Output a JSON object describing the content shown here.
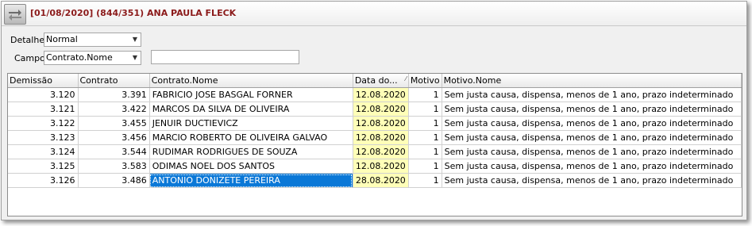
{
  "window": {
    "title": "[01/08/2020] (844/351) ANA PAULA FLECK",
    "nav_icon": "swap-arrows-icon"
  },
  "filters": {
    "detalhe_label": "Detalhe",
    "detalhe_value": "Normal",
    "campo_label": "Campo",
    "campo_value": "Contrato.Nome",
    "search_value": ""
  },
  "colors": {
    "title": "#8b1a1a",
    "date_highlight": "#ffffb8",
    "selection": "#0a78d7"
  },
  "table": {
    "columns": [
      "Demissão",
      "Contrato",
      "Contrato.Nome",
      "Data do...",
      "Motivo",
      "Motivo.Nome"
    ],
    "sorted_column": "Data do...",
    "rows": [
      [
        "3.120",
        "3.391",
        "FABRICIO JOSE BASGAL FORNER",
        "12.08.2020",
        "1",
        "Sem justa causa, dispensa, menos de 1 ano, prazo indeterminado"
      ],
      [
        "3.121",
        "3.422",
        "MARCOS DA SILVA DE OLIVEIRA",
        "12.08.2020",
        "1",
        "Sem justa causa, dispensa, menos de 1 ano, prazo indeterminado"
      ],
      [
        "3.122",
        "3.455",
        "JENUIR DUCTIEVICZ",
        "12.08.2020",
        "1",
        "Sem justa causa, dispensa, menos de 1 ano, prazo indeterminado"
      ],
      [
        "3.123",
        "3.456",
        "MARCIO ROBERTO DE OLIVEIRA GALVAO",
        "12.08.2020",
        "1",
        "Sem justa causa, dispensa, menos de 1 ano, prazo indeterminado"
      ],
      [
        "3.124",
        "3.544",
        "RUDIMAR RODRIGUES DE SOUZA",
        "12.08.2020",
        "1",
        "Sem justa causa, dispensa, menos de 1 ano, prazo indeterminado"
      ],
      [
        "3.125",
        "3.583",
        "ODIMAS NOEL DOS SANTOS",
        "12.08.2020",
        "1",
        "Sem justa causa, dispensa, menos de 1 ano, prazo indeterminado"
      ],
      [
        "3.126",
        "3.486",
        "ANTONIO DONIZETE PEREIRA",
        "28.08.2020",
        "1",
        "Sem justa causa, dispensa, menos de 1 ano, prazo indeterminado"
      ]
    ],
    "selected_row": 6
  }
}
